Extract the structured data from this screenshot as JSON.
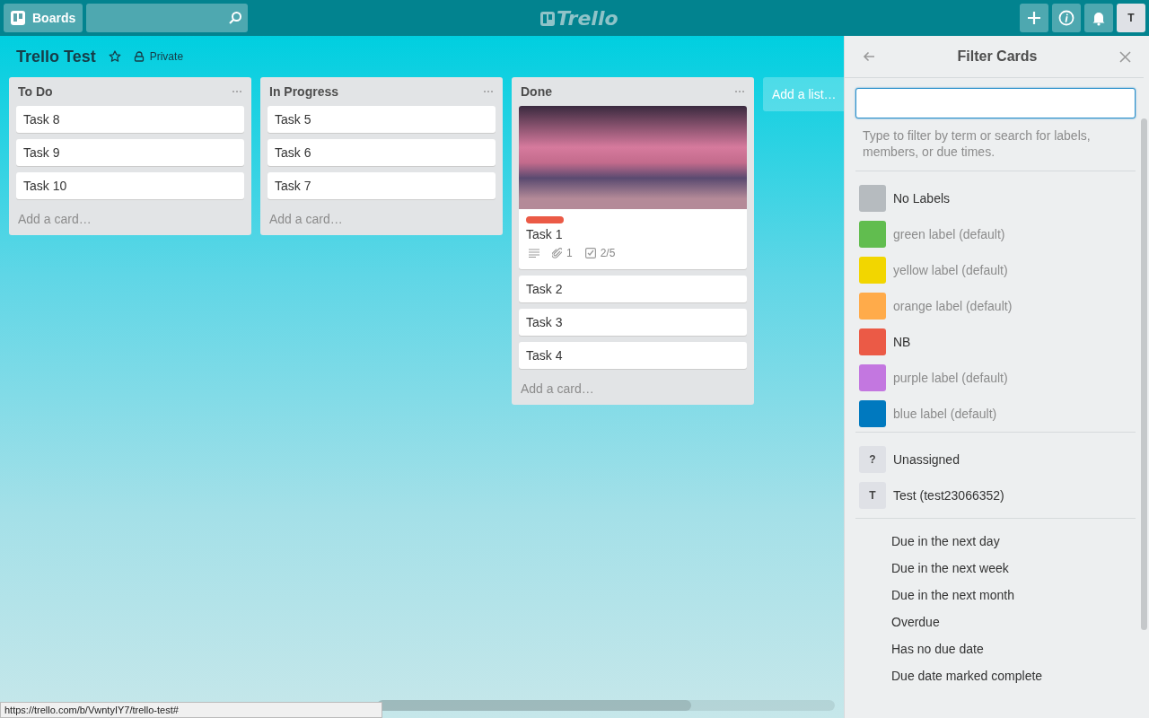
{
  "header": {
    "boards_button": "Boards",
    "logo": "Trello",
    "avatar": "T"
  },
  "board": {
    "title": "Trello Test",
    "visibility": "Private"
  },
  "lists": [
    {
      "name": "To Do",
      "cards": [
        {
          "title": "Task 8"
        },
        {
          "title": "Task 9"
        },
        {
          "title": "Task 10"
        }
      ],
      "add_card": "Add a card…"
    },
    {
      "name": "In Progress",
      "cards": [
        {
          "title": "Task 5"
        },
        {
          "title": "Task 6"
        },
        {
          "title": "Task 7"
        }
      ],
      "add_card": "Add a card…"
    },
    {
      "name": "Done",
      "cards": [
        {
          "title": "Task 1",
          "cover": true,
          "color": "#eb5a46",
          "attachments": "1",
          "checklist": "2/5"
        },
        {
          "title": "Task 2"
        },
        {
          "title": "Task 3"
        },
        {
          "title": "Task 4"
        }
      ],
      "add_card": "Add a card…"
    }
  ],
  "add_list": "Add a list…",
  "filter_panel": {
    "title": "Filter Cards",
    "hint": "Type to filter by term or search for labels, members, or due times.",
    "labels": [
      {
        "name": "No Labels",
        "color": "#b6bbbf",
        "dimmed": false
      },
      {
        "name": "green label (default)",
        "color": "#61bd4f",
        "dimmed": true
      },
      {
        "name": "yellow label (default)",
        "color": "#f2d600",
        "dimmed": true
      },
      {
        "name": "orange label (default)",
        "color": "#ffab4a",
        "dimmed": true
      },
      {
        "name": "NB",
        "color": "#eb5a46",
        "dimmed": false
      },
      {
        "name": "purple label (default)",
        "color": "#c377e0",
        "dimmed": true
      },
      {
        "name": "blue label (default)",
        "color": "#0079bf",
        "dimmed": true
      }
    ],
    "members": [
      {
        "initial": "?",
        "name": "Unassigned"
      },
      {
        "initial": "T",
        "name": "Test (test23066352)"
      }
    ],
    "due": [
      "Due in the next day",
      "Due in the next week",
      "Due in the next month",
      "Overdue",
      "Has no due date",
      "Due date marked complete"
    ]
  },
  "status_url": "https://trello.com/b/VwntyIY7/trello-test#"
}
